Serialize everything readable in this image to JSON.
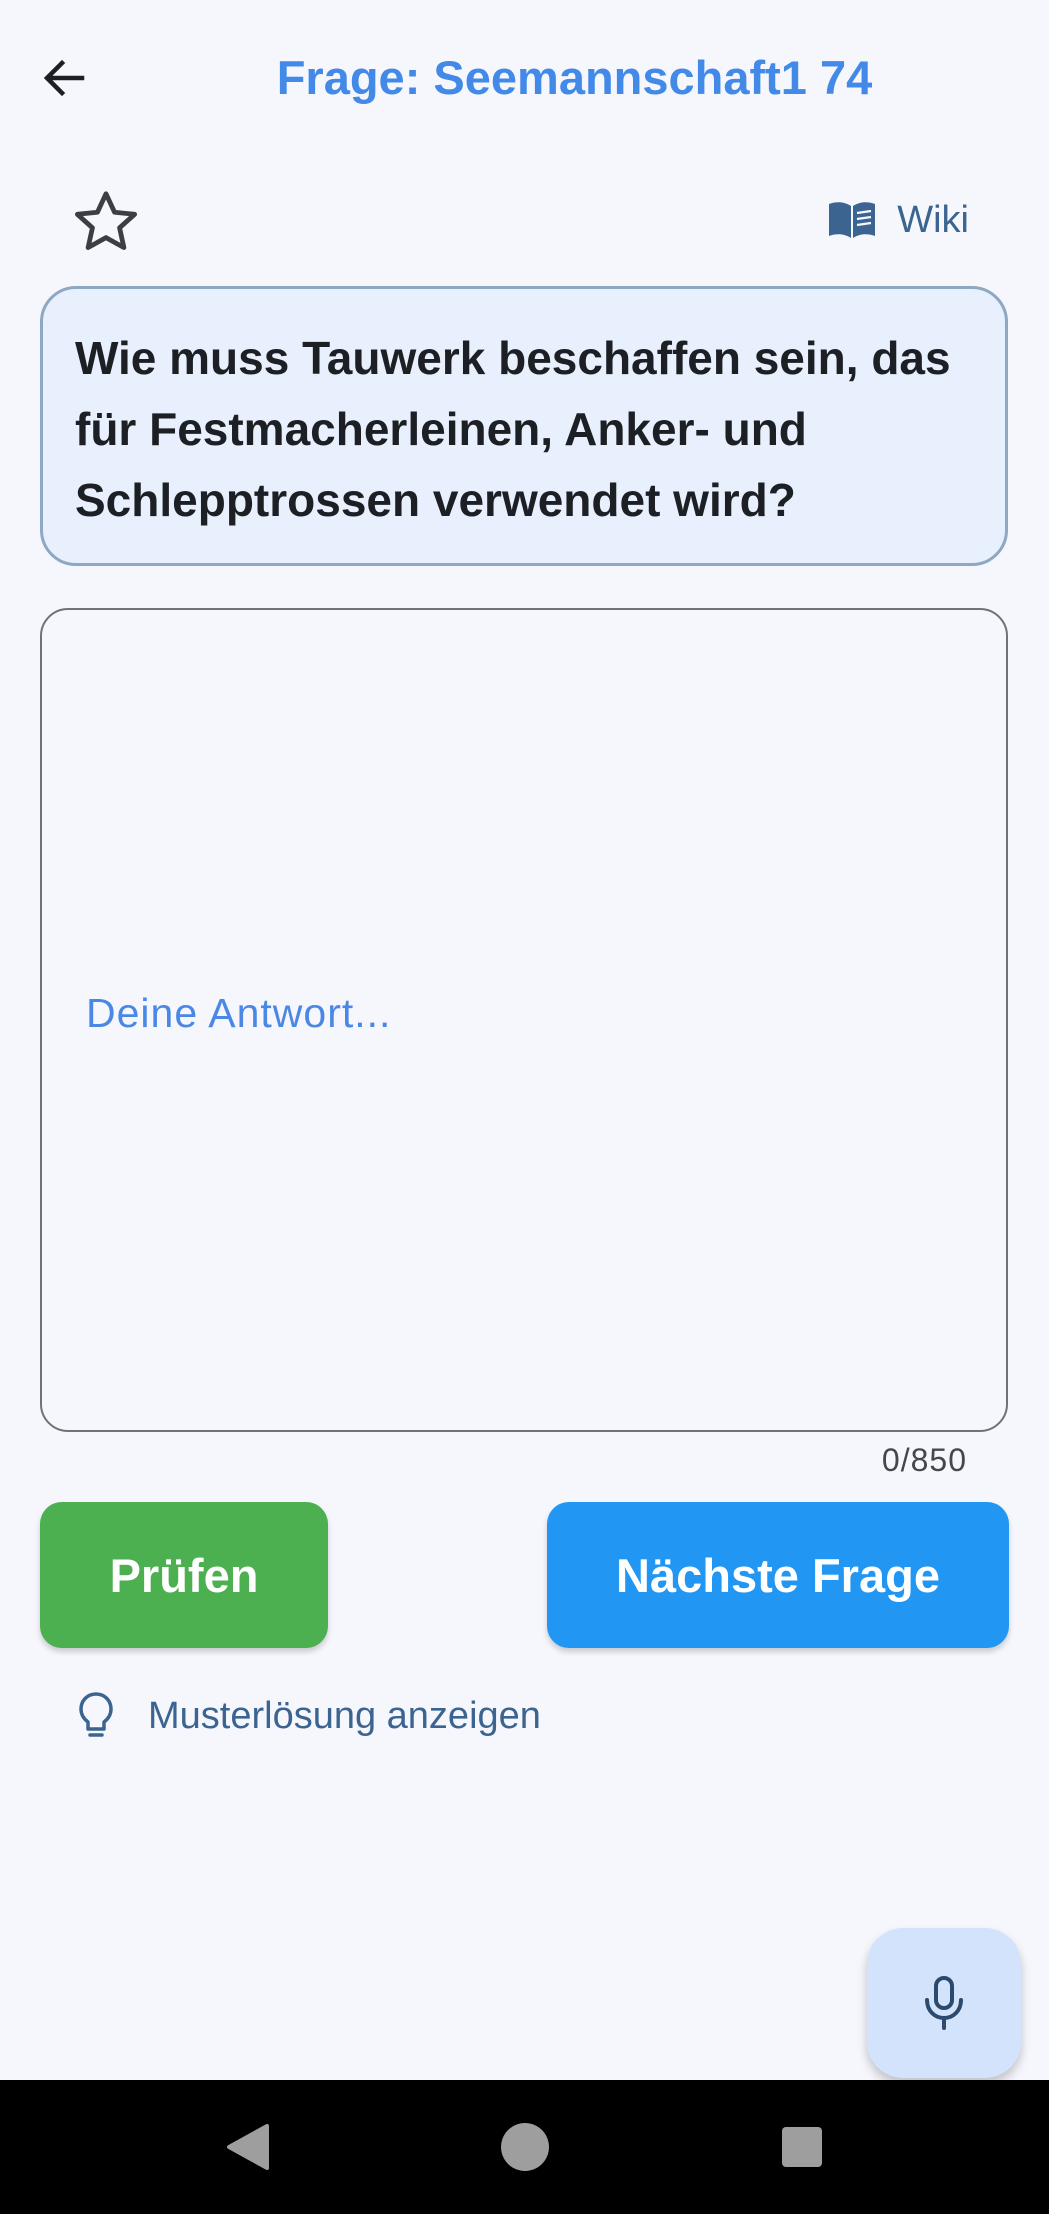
{
  "header": {
    "back_icon": "arrow-left-icon",
    "title": "Frage: Seemannschaft1 74",
    "title_color": "#4289e8"
  },
  "toolbar": {
    "favorite_icon": "star-outline-icon",
    "wiki_icon": "book-icon",
    "wiki_label": "Wiki"
  },
  "question": {
    "text": "Wie muss Tauwerk beschaffen sein, das für Festmacherleinen, Anker- und Schlepptrossen verwendet wird?"
  },
  "answer": {
    "value": "",
    "placeholder": "Deine Antwort...",
    "counter": "0/850"
  },
  "actions": {
    "check_label": "Prüfen",
    "check_color": "#4caf50",
    "next_label": "Nächste Frage",
    "next_color": "#2196f3"
  },
  "solution": {
    "icon": "lightbulb-icon",
    "label": "Musterlösung anzeigen"
  },
  "fab": {
    "icon": "microphone-icon"
  },
  "system_nav": {
    "back_icon": "triangle-back-icon",
    "home_icon": "circle-home-icon",
    "recents_icon": "square-recents-icon"
  }
}
